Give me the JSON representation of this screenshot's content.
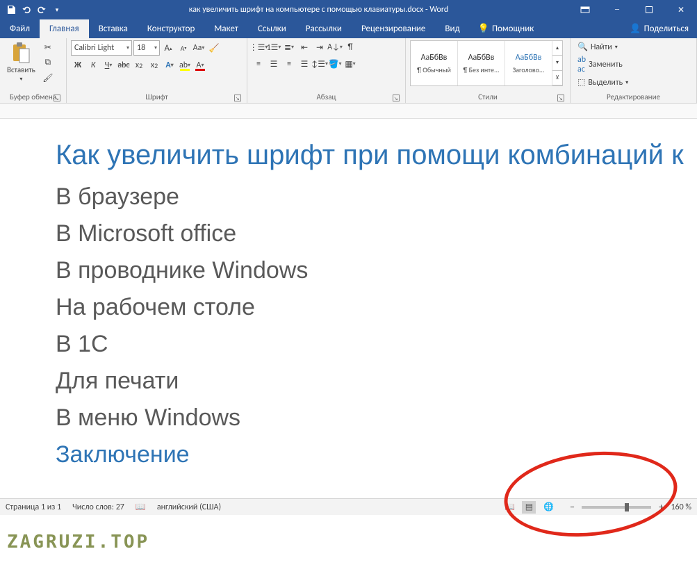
{
  "title": "как увеличить шрифт на компьютере с помощью клавиатуры.docx  -  Word",
  "tabs": [
    "Файл",
    "Главная",
    "Вставка",
    "Конструктор",
    "Макет",
    "Ссылки",
    "Рассылки",
    "Рецензирование",
    "Вид"
  ],
  "active_tab": "Главная",
  "tell_me": "Помощник",
  "share": "Поделиться",
  "ribbon": {
    "clipboard": {
      "paste": "Вставить",
      "label": "Буфер обмена"
    },
    "font": {
      "name": "Calibri Light",
      "size": "18",
      "label": "Шрифт"
    },
    "paragraph": {
      "label": "Абзац"
    },
    "styles": {
      "items": [
        {
          "sample": "АаБбВв",
          "name": "¶ Обычный"
        },
        {
          "sample": "АаБбВв",
          "name": "¶ Без инте..."
        },
        {
          "sample": "АаБбВв",
          "name": "Заголово...",
          "color": "#2e74b5"
        }
      ],
      "label": "Стили"
    },
    "editing": {
      "find": "Найти",
      "replace": "Заменить",
      "select": "Выделить",
      "label": "Редактирование"
    }
  },
  "document": {
    "heading": "Как увеличить шрифт при помощи комбинаций к",
    "lines": [
      "В браузере",
      "В Microsoft office",
      "В проводнике Windows",
      "На рабочем столе",
      "В 1С",
      "Для печати",
      "В меню Windows"
    ],
    "closing": "Заключение"
  },
  "status": {
    "page": "Страница 1 из 1",
    "words": "Число слов: 27",
    "lang": "английский (США)",
    "zoom": "160 %"
  },
  "watermark": "ZAGRUZI.TOP"
}
